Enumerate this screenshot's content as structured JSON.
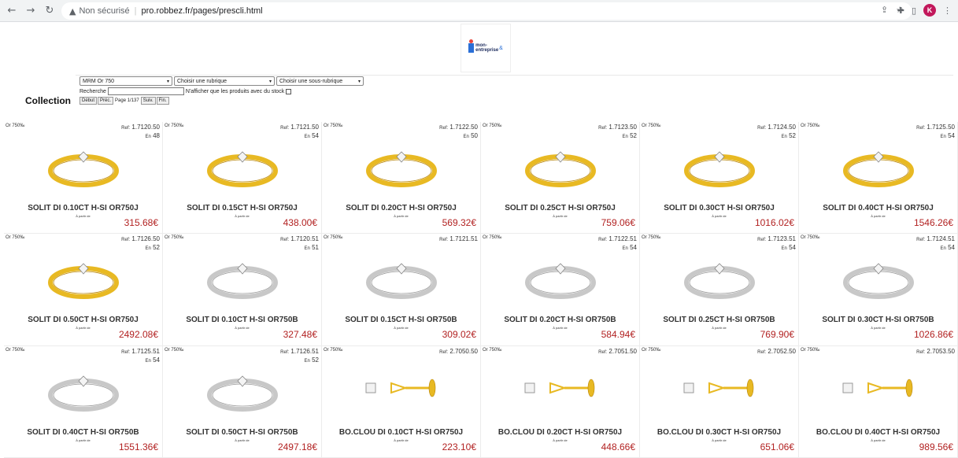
{
  "browser": {
    "insecure_label": "Non sécurisé",
    "url": "pro.robbez.fr/pages/prescli.html",
    "profile_initial": "K"
  },
  "header": {
    "logo_line1": "mon-",
    "logo_line2": "entreprise",
    "logo_amp": "&",
    "collection_title": "Collection"
  },
  "filters": {
    "metal_select": "MRM Or 750",
    "rubrique_select": "Choisir une rubrique",
    "sous_rubrique_select": "Choisir une sous-rubrique",
    "search_label": "Recherche",
    "search_value": "",
    "stock_only_label": "N'afficher que les produits avec du stock",
    "first_button": "Début",
    "prev_button": "Préc.",
    "page_label": "Page 1/137",
    "next_button": "Suiv.",
    "last_button": "Fin."
  },
  "labels": {
    "ref_prefix": "Ref:",
    "size_prefix": "En",
    "from_label": "À partir de"
  },
  "products": [
    {
      "metal": "Or 750‰",
      "ref": "1.7120.50",
      "size": "48",
      "name": "SOLIT DI 0.10CT H-SI OR750J",
      "price": "315.68€",
      "kind": "ring",
      "color": "yellow"
    },
    {
      "metal": "Or 750‰",
      "ref": "1.7121.50",
      "size": "54",
      "name": "SOLIT DI 0.15CT H-SI OR750J",
      "price": "438.00€",
      "kind": "ring",
      "color": "yellow"
    },
    {
      "metal": "Or 750‰",
      "ref": "1.7122.50",
      "size": "50",
      "name": "SOLIT DI 0.20CT H-SI OR750J",
      "price": "569.32€",
      "kind": "ring",
      "color": "yellow"
    },
    {
      "metal": "Or 750‰",
      "ref": "1.7123.50",
      "size": "52",
      "name": "SOLIT DI 0.25CT H-SI OR750J",
      "price": "759.06€",
      "kind": "ring",
      "color": "yellow"
    },
    {
      "metal": "Or 750‰",
      "ref": "1.7124.50",
      "size": "52",
      "name": "SOLIT DI 0.30CT H-SI OR750J",
      "price": "1016.02€",
      "kind": "ring",
      "color": "yellow"
    },
    {
      "metal": "Or 750‰",
      "ref": "1.7125.50",
      "size": "54",
      "name": "SOLIT DI 0.40CT H-SI OR750J",
      "price": "1546.26€",
      "kind": "ring",
      "color": "yellow"
    },
    {
      "metal": "Or 750‰",
      "ref": "1.7126.50",
      "size": "52",
      "name": "SOLIT DI 0.50CT H-SI OR750J",
      "price": "2492.08€",
      "kind": "ring",
      "color": "yellow"
    },
    {
      "metal": "Or 750‰",
      "ref": "1.7120.51",
      "size": "51",
      "name": "SOLIT DI 0.10CT H-SI OR750B",
      "price": "327.48€",
      "kind": "ring",
      "color": "white"
    },
    {
      "metal": "Or 750‰",
      "ref": "1.7121.51",
      "size": "",
      "name": "SOLIT DI 0.15CT H-SI OR750B",
      "price": "309.02€",
      "kind": "ring",
      "color": "white"
    },
    {
      "metal": "Or 750‰",
      "ref": "1.7122.51",
      "size": "54",
      "name": "SOLIT DI 0.20CT H-SI OR750B",
      "price": "584.94€",
      "kind": "ring",
      "color": "white"
    },
    {
      "metal": "Or 750‰",
      "ref": "1.7123.51",
      "size": "54",
      "name": "SOLIT DI 0.25CT H-SI OR750B",
      "price": "769.90€",
      "kind": "ring",
      "color": "white"
    },
    {
      "metal": "Or 750‰",
      "ref": "1.7124.51",
      "size": "54",
      "name": "SOLIT DI 0.30CT H-SI OR750B",
      "price": "1026.86€",
      "kind": "ring",
      "color": "white"
    },
    {
      "metal": "Or 750‰",
      "ref": "1.7125.51",
      "size": "54",
      "name": "SOLIT DI 0.40CT H-SI OR750B",
      "price": "1551.36€",
      "kind": "ring",
      "color": "white"
    },
    {
      "metal": "Or 750‰",
      "ref": "1.7126.51",
      "size": "52",
      "name": "SOLIT DI 0.50CT H-SI OR750B",
      "price": "2497.18€",
      "kind": "ring",
      "color": "white"
    },
    {
      "metal": "Or 750‰",
      "ref": "2.7050.50",
      "size": "",
      "name": "BO.CLOU DI 0.10CT H-SI OR750J",
      "price": "223.10€",
      "kind": "earring",
      "color": "yellow"
    },
    {
      "metal": "Or 750‰",
      "ref": "2.7051.50",
      "size": "",
      "name": "BO.CLOU DI 0.20CT H-SI OR750J",
      "price": "448.66€",
      "kind": "earring",
      "color": "yellow"
    },
    {
      "metal": "Or 750‰",
      "ref": "2.7052.50",
      "size": "",
      "name": "BO.CLOU DI 0.30CT H-SI OR750J",
      "price": "651.06€",
      "kind": "earring",
      "color": "yellow"
    },
    {
      "metal": "Or 750‰",
      "ref": "2.7053.50",
      "size": "",
      "name": "BO.CLOU DI 0.40CT H-SI OR750J",
      "price": "989.56€",
      "kind": "earring",
      "color": "yellow"
    }
  ],
  "colors": {
    "price": "#b22222",
    "gold": "#e8b923",
    "white_gold": "#c8c8c8"
  }
}
